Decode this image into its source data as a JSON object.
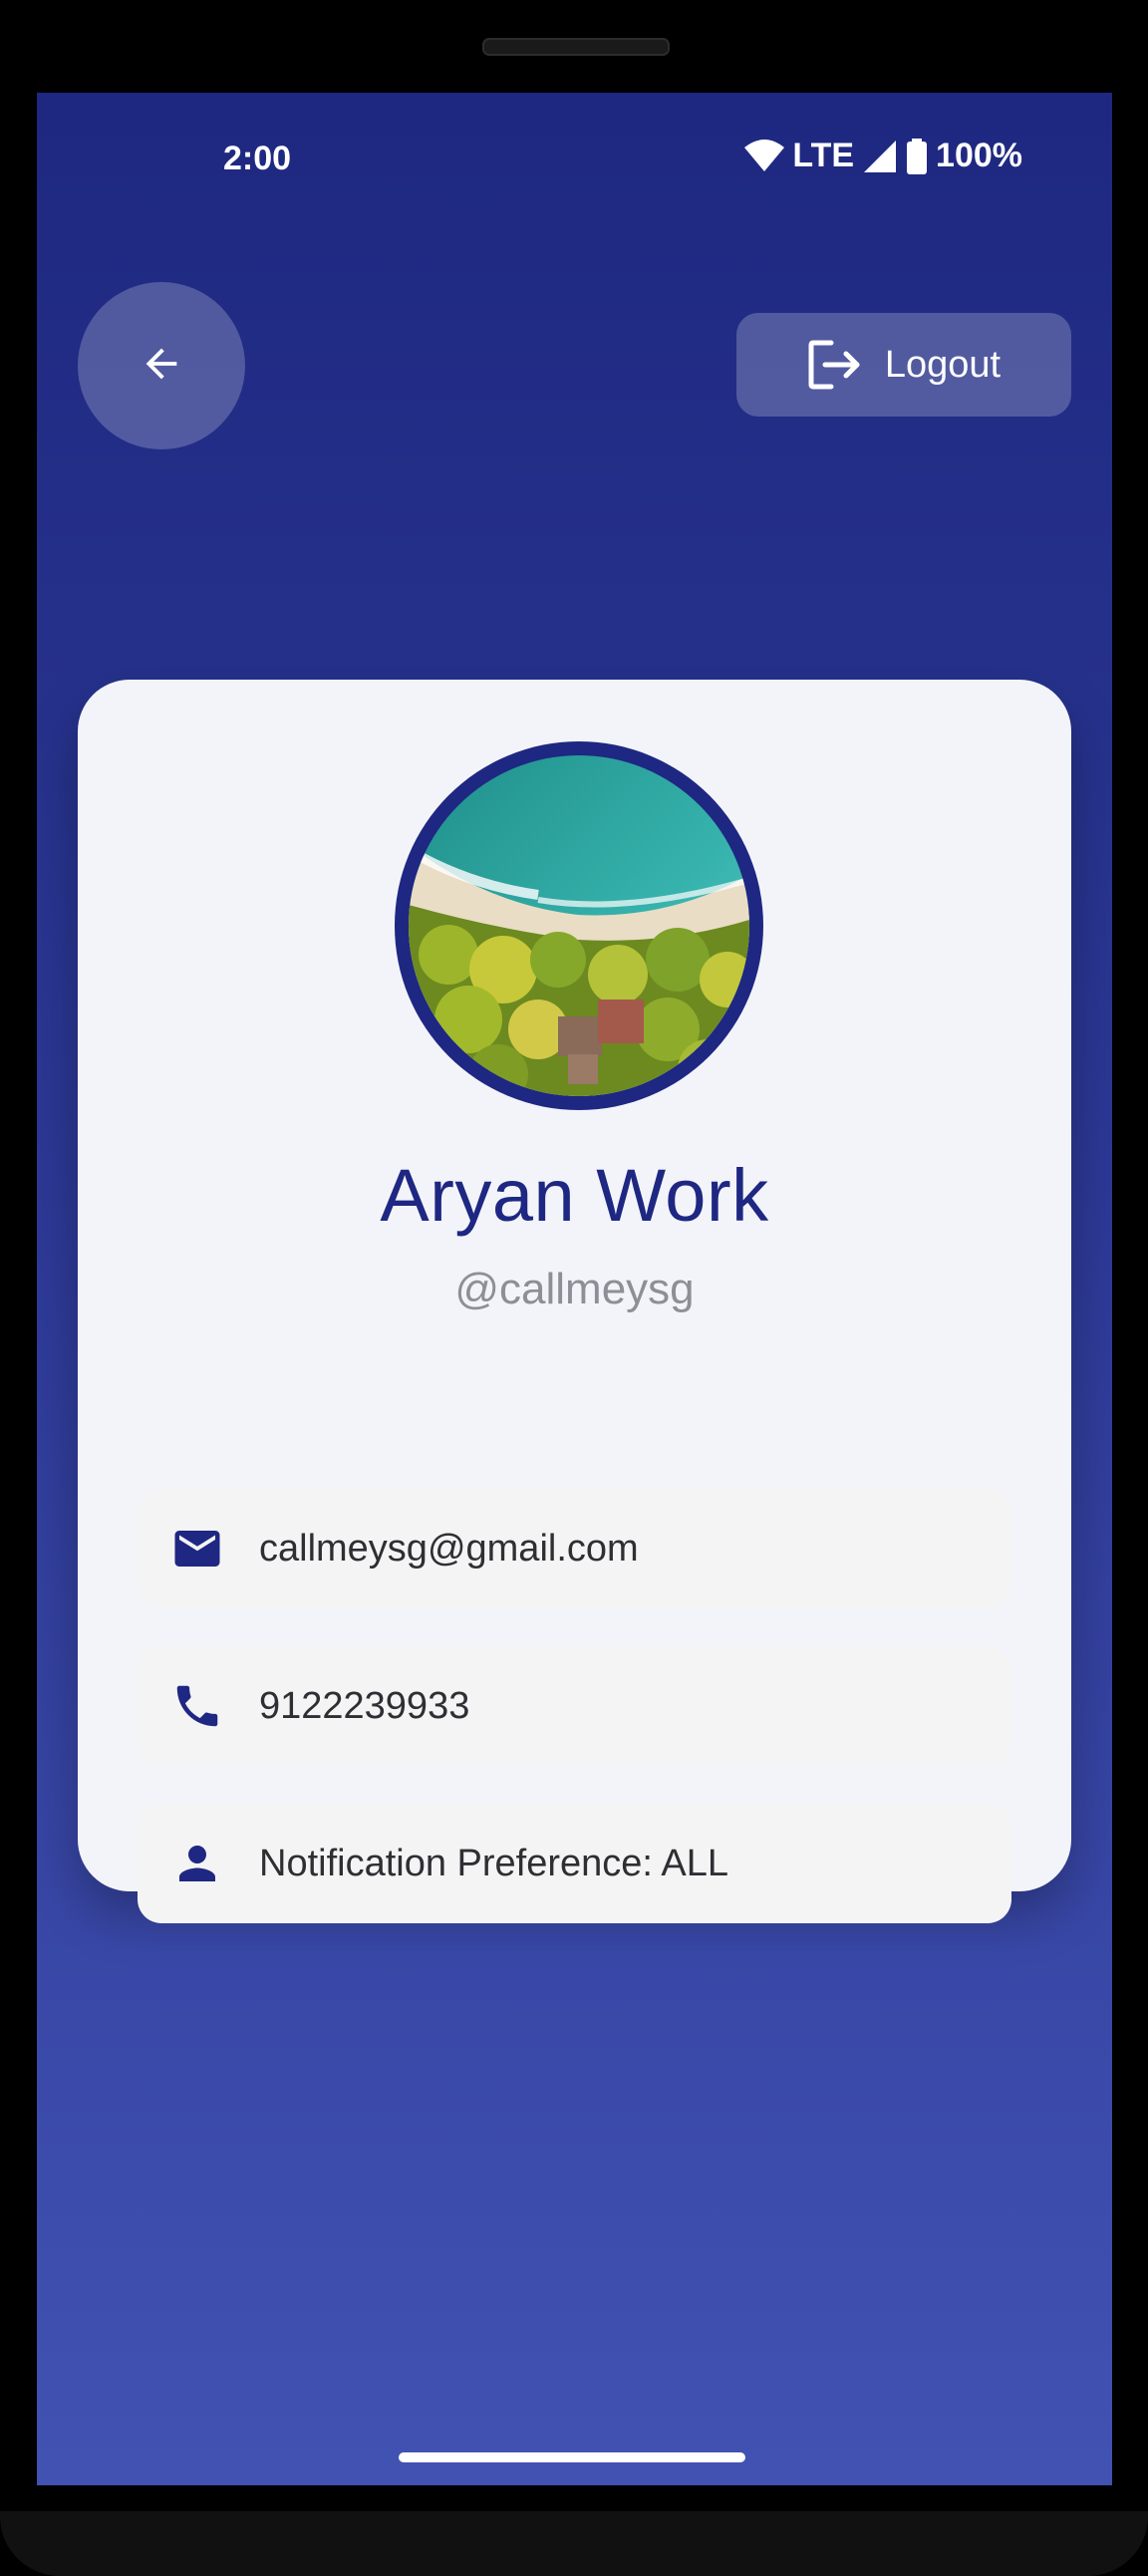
{
  "status_bar": {
    "time": "2:00",
    "network": "LTE",
    "battery": "100%",
    "icons": [
      "wifi-icon",
      "signal-icon",
      "battery-icon"
    ]
  },
  "header": {
    "back_icon": "arrow-left-icon",
    "logout_label": "Logout",
    "logout_icon": "logout-icon"
  },
  "profile": {
    "name": "Aryan Work",
    "handle": "@callmeysg",
    "avatar": "beach-aerial-photo"
  },
  "details": [
    {
      "icon": "mail-icon",
      "text": "callmeysg@gmail.com"
    },
    {
      "icon": "phone-icon",
      "text": "9122239933"
    },
    {
      "icon": "person-icon",
      "text": "Notification Preference: ALL"
    }
  ],
  "colors": {
    "primary": "#1e2782",
    "background_top": "#1e2880",
    "background_bottom": "#4152b3",
    "card": "#f3f4f9",
    "muted_text": "#8e8f96"
  }
}
